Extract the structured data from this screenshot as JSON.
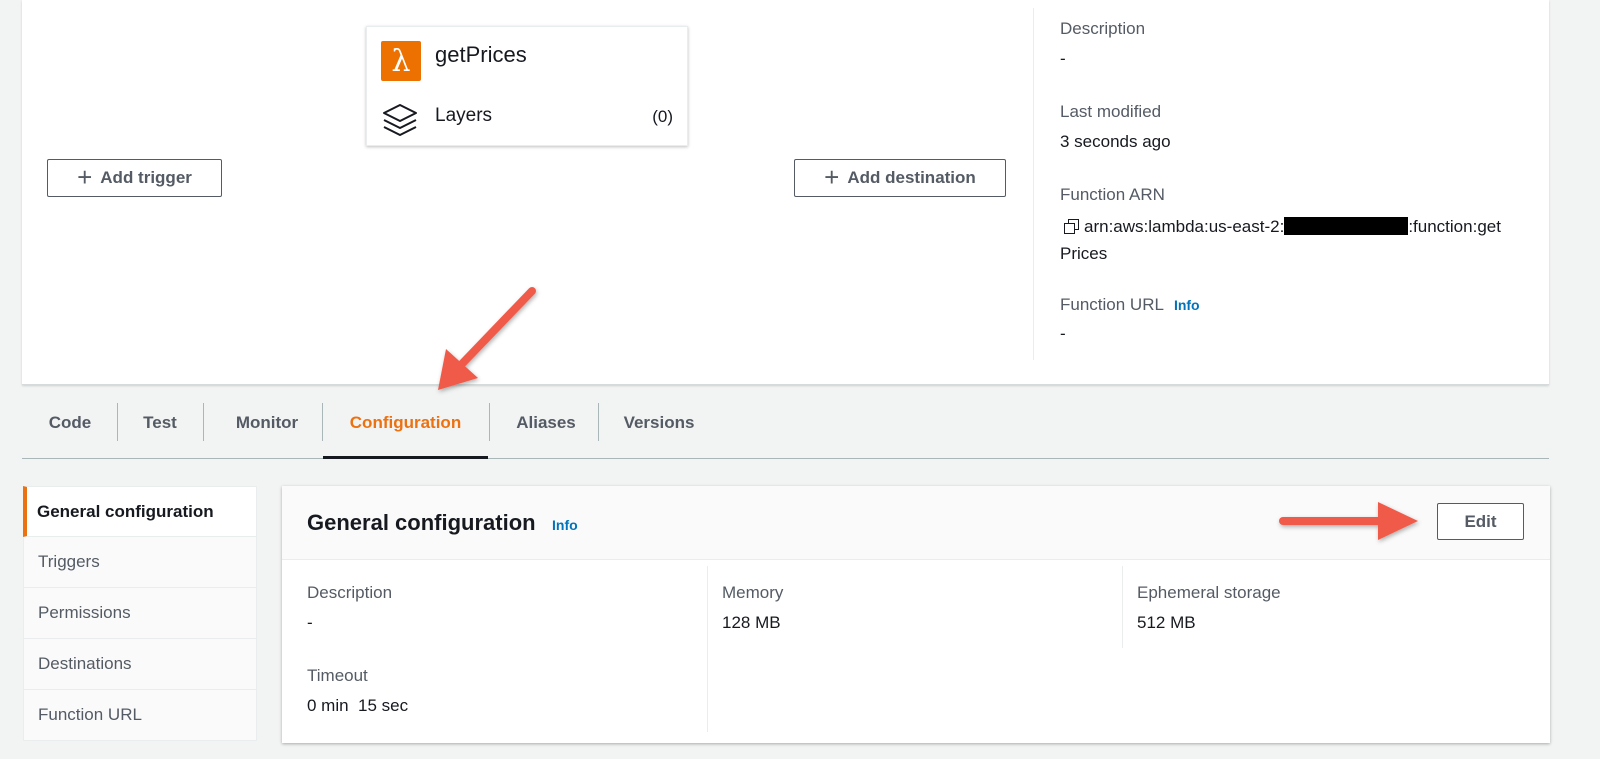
{
  "function_card": {
    "name": "getPrices",
    "lambda_glyph": "λ",
    "layers_label": "Layers",
    "layers_count": "(0)"
  },
  "buttons": {
    "add_trigger": "Add trigger",
    "add_destination": "Add destination",
    "plus": "+"
  },
  "details": {
    "description_label": "Description",
    "description_value": "-",
    "last_modified_label": "Last modified",
    "last_modified_value": "3 seconds ago",
    "arn_label": "Function ARN",
    "arn_prefix": "arn:aws:lambda:us-east-2:",
    "arn_suffix": ":function:get",
    "arn_suffix_line2": "Prices",
    "url_label": "Function URL",
    "url_info": "Info",
    "url_value": "-"
  },
  "tabs": [
    {
      "label": "Code"
    },
    {
      "label": "Test"
    },
    {
      "label": "Monitor"
    },
    {
      "label": "Configuration"
    },
    {
      "label": "Aliases"
    },
    {
      "label": "Versions"
    }
  ],
  "sidenav": [
    {
      "label": "General configuration"
    },
    {
      "label": "Triggers"
    },
    {
      "label": "Permissions"
    },
    {
      "label": "Destinations"
    },
    {
      "label": "Function URL"
    }
  ],
  "general_config": {
    "title": "General configuration",
    "info": "Info",
    "edit": "Edit",
    "description_label": "Description",
    "description_value": "-",
    "timeout_label": "Timeout",
    "timeout_value": "0 min  15 sec",
    "memory_label": "Memory",
    "memory_value": "128 MB",
    "storage_label": "Ephemeral storage",
    "storage_value": "512 MB"
  },
  "colors": {
    "accent_orange": "#ec7211",
    "lambda_orange": "#ed7100",
    "link_blue": "#0073bb",
    "arrow_red": "#f05a4a"
  }
}
